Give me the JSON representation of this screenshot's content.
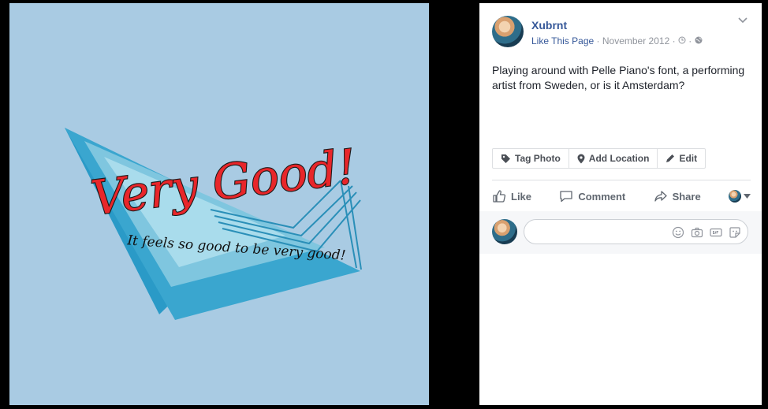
{
  "photo": {
    "headline": "Very Good!",
    "tagline": "It feels so good to be very good!"
  },
  "post": {
    "page_name": "Xubrnt",
    "like_link": "Like This Page",
    "separator": "·",
    "date": "November 2012",
    "text": "Playing around with Pelle Piano's font, a performing artist from Sweden, or is it Amsterdam?",
    "actions": {
      "tag_photo": "Tag Photo",
      "add_location": "Add Location",
      "edit": "Edit"
    },
    "reactions": {
      "like": "Like",
      "comment": "Comment",
      "share": "Share"
    },
    "comment": {
      "placeholder": ""
    }
  },
  "colors": {
    "link": "#365899",
    "photo_bg": "#a9cbe3",
    "headline": "#e8262a",
    "kite": "#3aa6cf"
  }
}
